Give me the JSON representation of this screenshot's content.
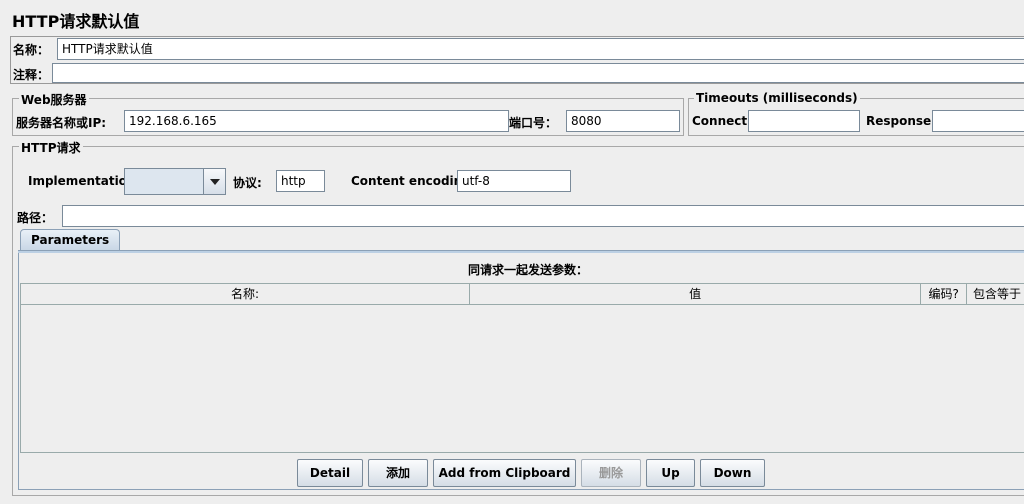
{
  "window": {
    "title": "HTTP请求默认值"
  },
  "name_row": {
    "label": "名称：",
    "value": "HTTP请求默认值"
  },
  "comment_row": {
    "label": "注释：",
    "value": ""
  },
  "web_server": {
    "title": "Web服务器",
    "server_label": "服务器名称或IP:",
    "server_value": "192.168.6.165",
    "port_label": "端口号：",
    "port_value": "8080"
  },
  "timeouts": {
    "title": "Timeouts (milliseconds)",
    "connect_label": "Connect:",
    "connect_value": "",
    "response_label": "Response:",
    "response_value": ""
  },
  "http_request": {
    "title": "HTTP请求",
    "implementation_label": "Implementation:",
    "implementation_value": "",
    "protocol_label": "协议:",
    "protocol_value": "http",
    "encoding_label": "Content encoding:",
    "encoding_value": "utf-8",
    "path_label": "路径：",
    "path_value": ""
  },
  "parameters": {
    "tab_label": "Parameters",
    "caption": "同请求一起发送参数：",
    "columns": [
      "名称:",
      "值",
      "编码?",
      "包含等于"
    ],
    "rows": []
  },
  "buttons": {
    "detail": "Detail",
    "add": "添加",
    "add_clipboard": "Add from Clipboard",
    "delete": "删除",
    "up": "Up",
    "down": "Down"
  }
}
